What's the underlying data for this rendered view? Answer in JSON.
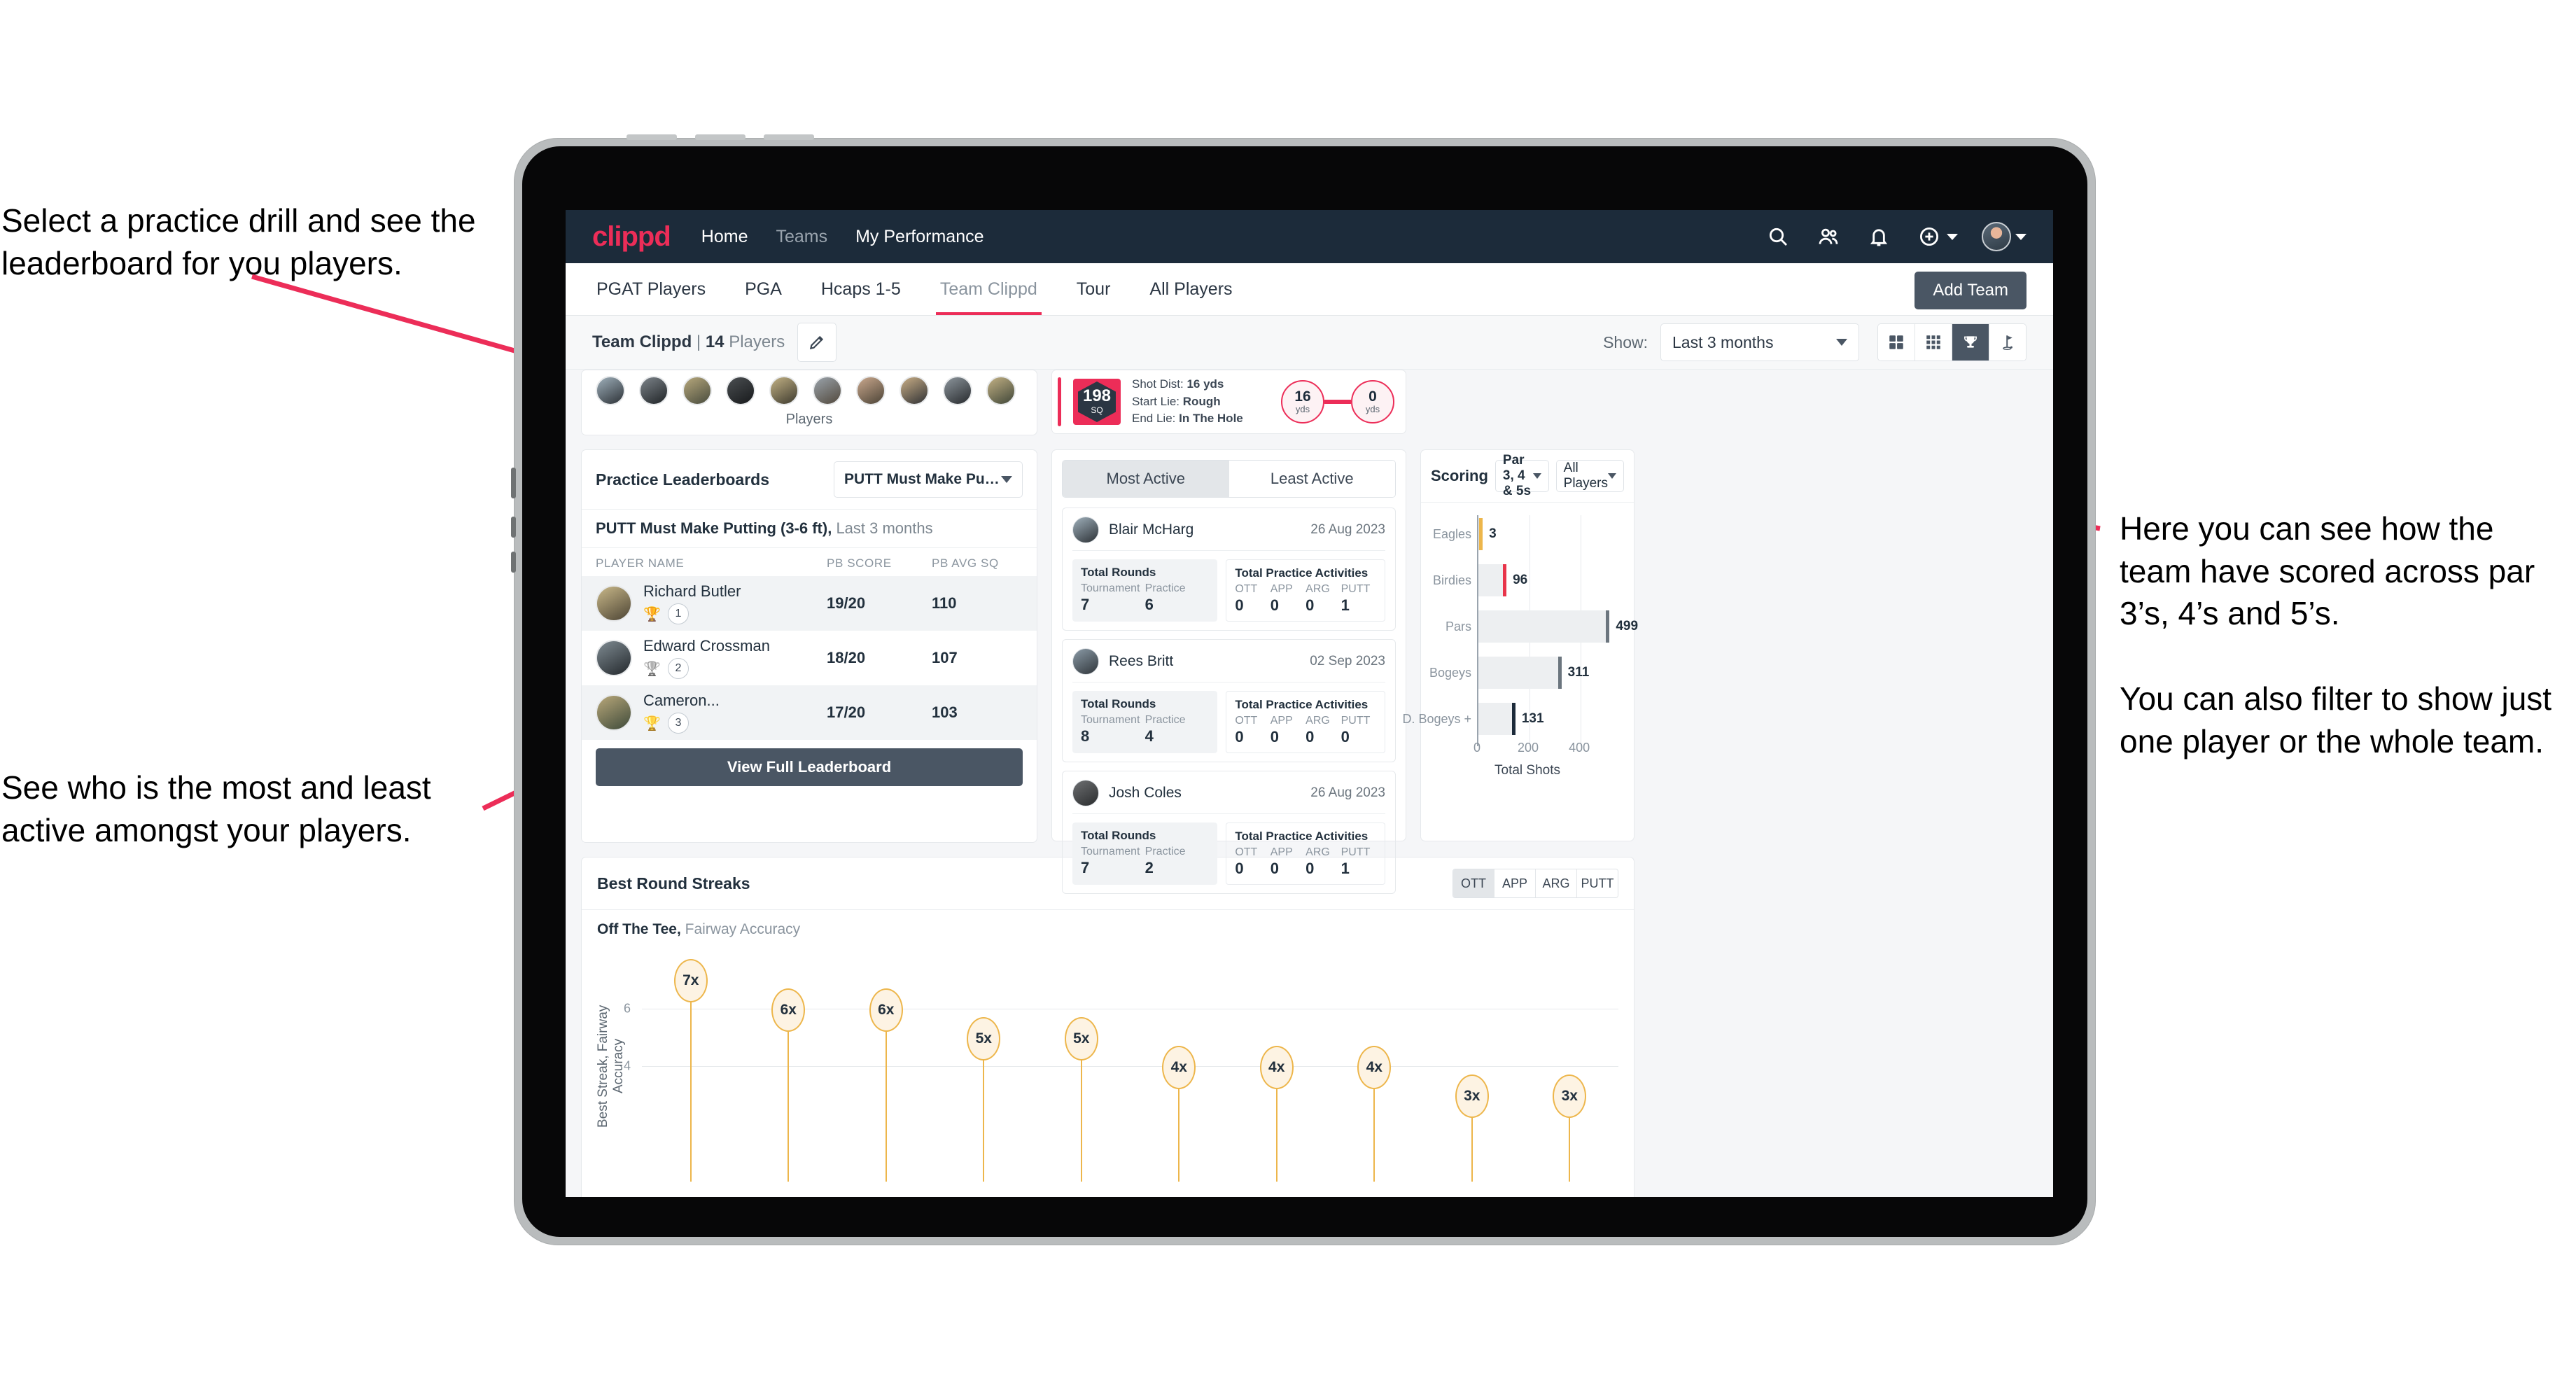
{
  "annotations": {
    "top_left": "Select a practice drill and see the leaderboard for you players.",
    "bottom_left": "See who is the most and least active amongst your players.",
    "right": "Here you can see how the team have scored across par 3’s, 4’s and 5’s.\n\nYou can also filter to show just one player or the whole team."
  },
  "appbar": {
    "logo": "clippd",
    "links": [
      {
        "label": "Home",
        "dim": false
      },
      {
        "label": "Teams",
        "dim": true
      },
      {
        "label": "My Performance",
        "dim": false
      }
    ],
    "icons": [
      "search-icon",
      "people-icon",
      "bell-icon",
      "plus-circle-icon",
      "avatar"
    ]
  },
  "tabs": {
    "items": [
      {
        "label": "PGAT Players",
        "active": false
      },
      {
        "label": "PGA",
        "active": false
      },
      {
        "label": "Hcaps 1-5",
        "active": false
      },
      {
        "label": "Team Clippd",
        "active": true
      },
      {
        "label": "Tour",
        "active": false
      },
      {
        "label": "All Players",
        "active": false
      }
    ],
    "add_team_label": "Add Team"
  },
  "subheader": {
    "team_name": "Team Clippd",
    "separator": "|",
    "player_count": "14",
    "players_word": "Players",
    "show_label": "Show:",
    "show_value": "Last 3 months",
    "view_modes": [
      {
        "name": "grid-4-icon",
        "active": false
      },
      {
        "name": "grid-9-icon",
        "active": false
      },
      {
        "name": "trophy-icon",
        "active": true
      },
      {
        "name": "flag-icon",
        "active": false
      }
    ]
  },
  "players_strip": {
    "caption": "Players",
    "count": 10
  },
  "shot_card": {
    "sq_value": "198",
    "sq_unit": "SQ",
    "lines": [
      {
        "label": "Shot Dist:",
        "value": "16 yds"
      },
      {
        "label": "Start Lie:",
        "value": "Rough"
      },
      {
        "label": "End Lie:",
        "value": "In The Hole"
      }
    ],
    "start_dist": {
      "value": "16",
      "unit": "yds"
    },
    "end_dist": {
      "value": "0",
      "unit": "yds"
    }
  },
  "leaderboard": {
    "title": "Practice Leaderboards",
    "drill_select": "PUTT Must Make Putting ...",
    "subtitle_bold": "PUTT Must Make Putting (3-6 ft),",
    "subtitle_rest": " Last 3 months",
    "columns": [
      "PLAYER NAME",
      "PB SCORE",
      "PB AVG SQ"
    ],
    "rows": [
      {
        "name": "Richard Butler",
        "rank": "1",
        "trophy": "gold",
        "score": "19/20",
        "sq": "110"
      },
      {
        "name": "Edward Crossman",
        "rank": "2",
        "trophy": "silver",
        "score": "18/20",
        "sq": "107"
      },
      {
        "name": "Cameron...",
        "rank": "3",
        "trophy": "bronze",
        "score": "17/20",
        "sq": "103"
      }
    ],
    "view_full_label": "View Full Leaderboard"
  },
  "activity": {
    "tabs": [
      {
        "label": "Most Active",
        "active": true
      },
      {
        "label": "Least Active",
        "active": false
      }
    ],
    "rounds_title": "Total Rounds",
    "practice_title": "Total Practice Activities",
    "rounds_keys": [
      "Tournament",
      "Practice"
    ],
    "practice_keys": [
      "OTT",
      "APP",
      "ARG",
      "PUTT"
    ],
    "items": [
      {
        "name": "Blair McHarg",
        "date": "26 Aug 2023",
        "rounds": [
          "7",
          "6"
        ],
        "practice": [
          "0",
          "0",
          "0",
          "1"
        ]
      },
      {
        "name": "Rees Britt",
        "date": "02 Sep 2023",
        "rounds": [
          "8",
          "4"
        ],
        "practice": [
          "0",
          "0",
          "0",
          "0"
        ]
      },
      {
        "name": "Josh Coles",
        "date": "26 Aug 2023",
        "rounds": [
          "7",
          "2"
        ],
        "practice": [
          "0",
          "0",
          "0",
          "1"
        ]
      }
    ]
  },
  "scoring": {
    "title": "Scoring",
    "par_select": "Par 3, 4 & 5s",
    "player_select": "All Players"
  },
  "streaks": {
    "title": "Best Round Streaks",
    "toggles": [
      {
        "label": "OTT",
        "active": true
      },
      {
        "label": "APP",
        "active": false
      },
      {
        "label": "ARG",
        "active": false
      },
      {
        "label": "PUTT",
        "active": false
      }
    ],
    "sub_bold": "Off The Tee,",
    "sub_rest": " Fairway Accuracy"
  },
  "chart_data": [
    {
      "type": "bar",
      "orientation": "horizontal",
      "title": "Scoring",
      "categories": [
        "Eagles",
        "Birdies",
        "Pars",
        "Bogeys",
        "D. Bogeys +"
      ],
      "values": [
        3,
        96,
        499,
        311,
        131
      ],
      "bar_colors": [
        "#edb64b",
        "#e8344a",
        "#6b757e",
        "#6b757e",
        "#1c2b3a"
      ],
      "xlabel": "Total Shots",
      "ylabel": "",
      "xlim": [
        0,
        520
      ],
      "xticks": [
        0,
        200,
        400
      ],
      "grid": true,
      "legend": "none"
    },
    {
      "type": "scatter",
      "subtype": "lollipop",
      "title": "Best Round Streaks",
      "subtitle": "Off The Tee, Fairway Accuracy",
      "ylabel": "Best Streak, Fairway Accuracy",
      "values": [
        7,
        6,
        6,
        5,
        5,
        4,
        4,
        4,
        3,
        3
      ],
      "labels": [
        "7x",
        "6x",
        "6x",
        "5x",
        "5x",
        "4x",
        "4x",
        "4x",
        "3x",
        "3x"
      ],
      "yticks": [
        4,
        6
      ],
      "ylim": [
        0,
        8
      ],
      "grid": true,
      "accent": "#edb64b"
    }
  ],
  "colors": {
    "brand_pink": "#ec2d58",
    "navy": "#1c2b3a",
    "slate": "#4a5664",
    "gold": "#edb64b"
  }
}
